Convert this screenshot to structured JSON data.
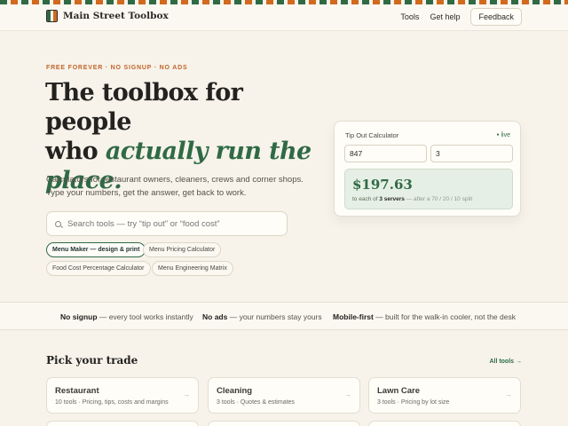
{
  "brand": {
    "name": "Main Street Toolbox"
  },
  "nav": {
    "tools": "Tools",
    "help": "Get help",
    "feedback": "Feedback"
  },
  "hero": {
    "kicker": "FREE FOREVER · NO SIGNUP · NO ADS",
    "title_line1": "The toolbox for people",
    "title_who": "who ",
    "title_accent1": "actually run the",
    "title_accent2": "place.",
    "description": "Calculators for restaurant owners, cleaners, crews and corner shops. Type your numbers, get the answer, get back to work."
  },
  "search": {
    "placeholder": "Search tools — try “tip out” or “food cost”"
  },
  "chips": [
    "Menu Maker — design & print",
    "Menu Pricing Calculator",
    "Food Cost Percentage Calculator",
    "Menu Engineering Matrix"
  ],
  "calculator": {
    "title": "Tip Out Calculator",
    "live": "live",
    "amount_value": "847",
    "servers_value": "3",
    "result": "$197.63",
    "note_prefix": "to each of ",
    "note_servers": "3 servers",
    "note_suffix": " — after a 70 / 20 / 10 split"
  },
  "features": [
    {
      "title": "No signup",
      "text": " — every tool works instantly"
    },
    {
      "title": "No ads",
      "text": " — your numbers stay yours"
    },
    {
      "title": "Mobile-first",
      "text": " — built for the walk-in cooler, not the desk"
    }
  ],
  "trades": {
    "title": "Pick your trade",
    "all_link": "All tools →",
    "items": [
      {
        "name": "Restaurant",
        "meta": "10 tools · Pricing, tips, costs and margins"
      },
      {
        "name": "Cleaning",
        "meta": "3 tools · Quotes & estimates"
      },
      {
        "name": "Lawn Care",
        "meta": "3 tools · Pricing by lot size"
      }
    ],
    "arrow": "→"
  },
  "colors": {
    "accent": "#2f6a45",
    "kicker": "#c0652b",
    "background": "#f7f3ea"
  }
}
